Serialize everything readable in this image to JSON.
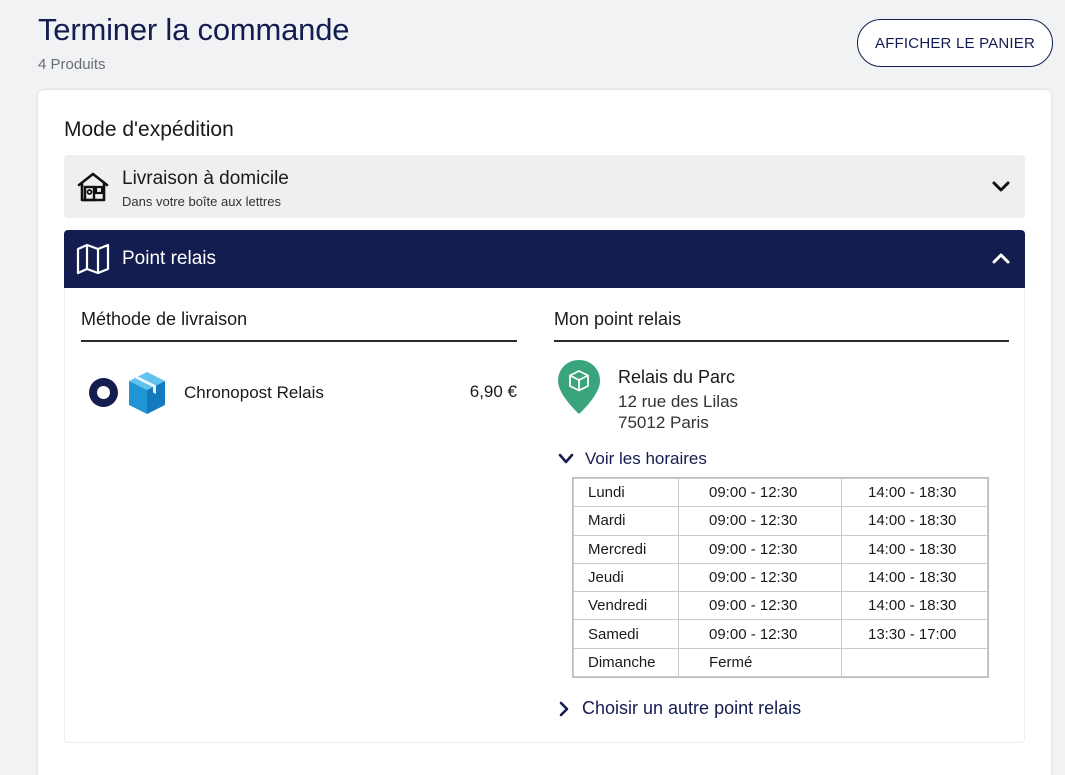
{
  "header": {
    "title": "Terminer la commande",
    "product_count": "4 Produits",
    "cart_button": "AFFICHER LE PANIER"
  },
  "shipping": {
    "section_title": "Mode d'expédition",
    "options": [
      {
        "title": "Livraison à domicile",
        "subtitle": "Dans votre boîte aux lettres",
        "icon": "house-icon",
        "expanded": false
      },
      {
        "title": "Point relais",
        "icon": "map-icon",
        "expanded": true
      }
    ]
  },
  "relay_panel": {
    "method_heading": "Méthode de livraison",
    "relay_heading": "Mon point relais",
    "method": {
      "carrier": "Chronopost Relais",
      "price": "6,90 €",
      "selected": true,
      "icon": "package-box-icon"
    },
    "relay_point": {
      "name": "Relais du Parc",
      "address_line1": "12 rue des Lilas",
      "address_line2": "75012 Paris",
      "icon": "location-pin-icon"
    },
    "hours_toggle": "Voir les horaires",
    "hours": [
      {
        "day": "Lundi",
        "morning": "09:00 - 12:30",
        "afternoon": "14:00 - 18:30"
      },
      {
        "day": "Mardi",
        "morning": "09:00 - 12:30",
        "afternoon": "14:00 - 18:30"
      },
      {
        "day": "Mercredi",
        "morning": "09:00 - 12:30",
        "afternoon": "14:00 - 18:30"
      },
      {
        "day": "Jeudi",
        "morning": "09:00 - 12:30",
        "afternoon": "14:00 - 18:30"
      },
      {
        "day": "Vendredi",
        "morning": "09:00 - 12:30",
        "afternoon": "14:00 - 18:30"
      },
      {
        "day": "Samedi",
        "morning": "09:00 - 12:30",
        "afternoon": "13:30 - 17:00"
      },
      {
        "day": "Dimanche",
        "morning": "Fermé",
        "afternoon": ""
      }
    ],
    "other_relay_link": "Choisir un autre point relais"
  },
  "colors": {
    "brand_navy": "#141d4f",
    "pin_green": "#3aa57c",
    "carrier_blue": "#1f95d6",
    "page_bg": "#f1f2f4"
  }
}
